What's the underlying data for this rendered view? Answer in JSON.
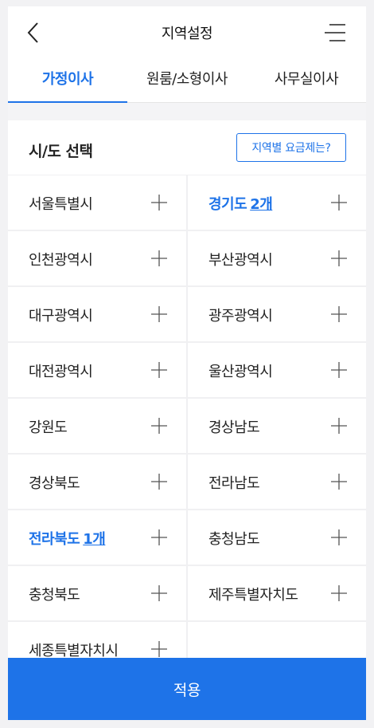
{
  "header": {
    "title": "지역설정"
  },
  "tabs": [
    {
      "label": "가정이사",
      "active": true
    },
    {
      "label": "원룸/소형이사",
      "active": false
    },
    {
      "label": "사무실이사",
      "active": false
    }
  ],
  "section": {
    "title": "시/도 선택",
    "fee_button": "지역별 요금제는?"
  },
  "regions": [
    {
      "label": "서울특별시",
      "count": ""
    },
    {
      "label": "경기도",
      "count": "2개"
    },
    {
      "label": "인천광역시",
      "count": ""
    },
    {
      "label": "부산광역시",
      "count": ""
    },
    {
      "label": "대구광역시",
      "count": ""
    },
    {
      "label": "광주광역시",
      "count": ""
    },
    {
      "label": "대전광역시",
      "count": ""
    },
    {
      "label": "울산광역시",
      "count": ""
    },
    {
      "label": "강원도",
      "count": ""
    },
    {
      "label": "경상남도",
      "count": ""
    },
    {
      "label": "경상북도",
      "count": ""
    },
    {
      "label": "전라남도",
      "count": ""
    },
    {
      "label": "전라북도",
      "count": "1개"
    },
    {
      "label": "충청남도",
      "count": ""
    },
    {
      "label": "충청북도",
      "count": ""
    },
    {
      "label": "제주특별자치도",
      "count": ""
    },
    {
      "label": "세종특별자치시",
      "count": ""
    }
  ],
  "apply_button": "적용",
  "colors": {
    "accent": "#1e73e8"
  },
  "icons": {
    "back": "chevron-left-icon",
    "menu": "menu-icon",
    "add": "plus-icon"
  }
}
